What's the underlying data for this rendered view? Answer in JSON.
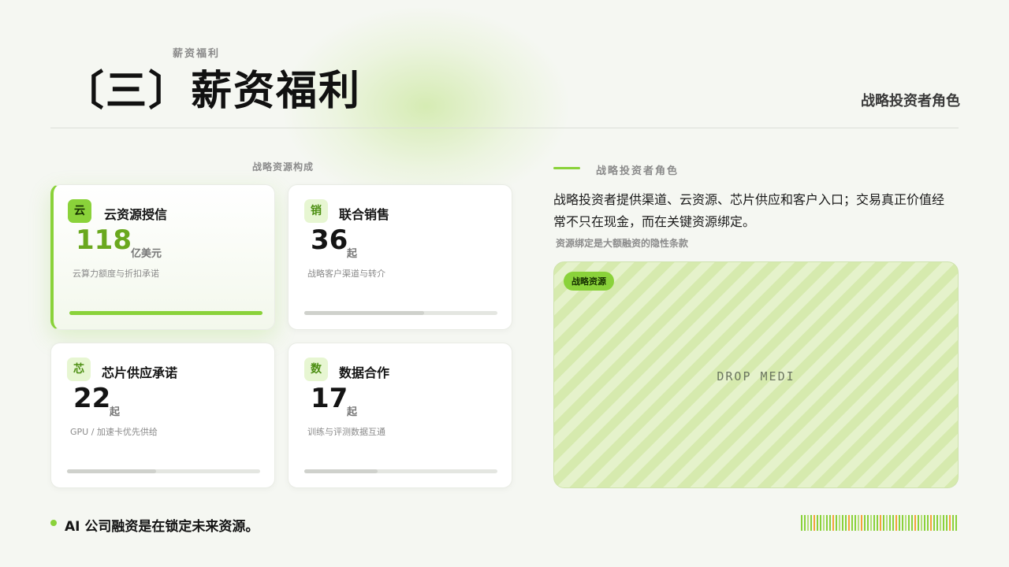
{
  "header": {
    "kicker": "薪资福利",
    "title": "〔三〕薪资福利",
    "top_right": "战略投资者角色"
  },
  "left": {
    "heading": "战略资源构成",
    "cards": [
      {
        "badge": "云",
        "title": "云资源授信",
        "value": "118",
        "unit": "亿美元",
        "desc": "云算力额度与折扣承诺",
        "progress": 1.0,
        "active": true
      },
      {
        "badge": "销",
        "title": "联合销售",
        "value": "36",
        "unit": "起",
        "desc": "战略客户渠道与转介",
        "progress": 0.62,
        "active": false
      },
      {
        "badge": "芯",
        "title": "芯片供应承诺",
        "value": "22",
        "unit": "起",
        "desc": "GPU /  加速卡优先供给",
        "progress": 0.46,
        "active": false
      },
      {
        "badge": "数",
        "title": "数据合作",
        "value": "17",
        "unit": "起",
        "desc": "训练与评测数据互通",
        "progress": 0.38,
        "active": false
      }
    ]
  },
  "right": {
    "heading": "战略投资者角色",
    "body": "战略投资者提供渠道、云资源、芯片供应和客户入口；交易真正价值经常不只在现金，而在关键资源绑定。",
    "note": "资源绑定是大额融资的隐性条款",
    "media_tag": "战略资源",
    "media_placeholder": "DROP MEDI"
  },
  "footer": {
    "text": "AI  公司融资是在锁定未来资源。"
  },
  "colors": {
    "accent": "#8ad23a",
    "accent_dark": "#6aa81e",
    "barcode": [
      "#8ad23a",
      "#f2a33a",
      "#b6de7a"
    ]
  }
}
